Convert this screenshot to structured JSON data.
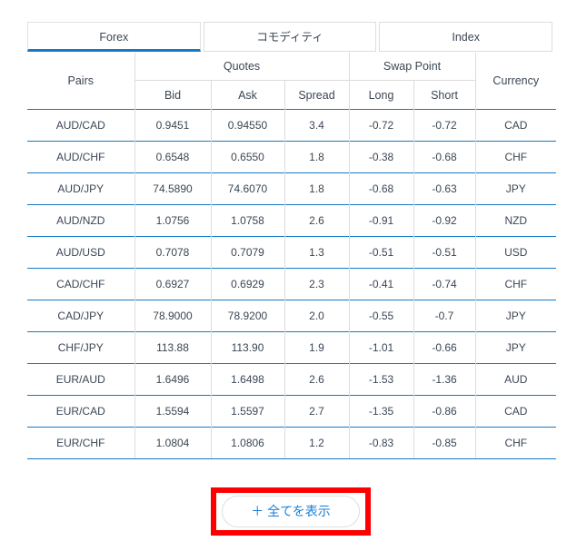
{
  "tabs": [
    {
      "label": "Forex",
      "active": true
    },
    {
      "label": "コモディティ",
      "active": false
    },
    {
      "label": "Index",
      "active": false
    }
  ],
  "table": {
    "headers": {
      "pairs": "Pairs",
      "quotes": "Quotes",
      "swap_point": "Swap Point",
      "currency": "Currency",
      "bid": "Bid",
      "ask": "Ask",
      "spread": "Spread",
      "long": "Long",
      "short": "Short"
    },
    "rows": [
      {
        "pair": "AUD/CAD",
        "bid": "0.9451",
        "ask": "0.94550",
        "spread": "3.4",
        "long": "-0.72",
        "short": "-0.72",
        "currency": "CAD"
      },
      {
        "pair": "AUD/CHF",
        "bid": "0.6548",
        "ask": "0.6550",
        "spread": "1.8",
        "long": "-0.38",
        "short": "-0.68",
        "currency": "CHF"
      },
      {
        "pair": "AUD/JPY",
        "bid": "74.5890",
        "ask": "74.6070",
        "spread": "1.8",
        "long": "-0.68",
        "short": "-0.63",
        "currency": "JPY"
      },
      {
        "pair": "AUD/NZD",
        "bid": "1.0756",
        "ask": "1.0758",
        "spread": "2.6",
        "long": "-0.91",
        "short": "-0.92",
        "currency": "NZD"
      },
      {
        "pair": "AUD/USD",
        "bid": "0.7078",
        "ask": "0.7079",
        "spread": "1.3",
        "long": "-0.51",
        "short": "-0.51",
        "currency": "USD"
      },
      {
        "pair": "CAD/CHF",
        "bid": "0.6927",
        "ask": "0.6929",
        "spread": "2.3",
        "long": "-0.41",
        "short": "-0.74",
        "currency": "CHF"
      },
      {
        "pair": "CAD/JPY",
        "bid": "78.9000",
        "ask": "78.9200",
        "spread": "2.0",
        "long": "-0.55",
        "short": "-0.7",
        "currency": "JPY"
      },
      {
        "pair": "CHF/JPY",
        "bid": "113.88",
        "ask": "113.90",
        "spread": "1.9",
        "long": "-1.01",
        "short": "-0.66",
        "currency": "JPY"
      },
      {
        "pair": "EUR/AUD",
        "bid": "1.6496",
        "ask": "1.6498",
        "spread": "2.6",
        "long": "-1.53",
        "short": "-1.36",
        "currency": "AUD"
      },
      {
        "pair": "EUR/CAD",
        "bid": "1.5594",
        "ask": "1.5597",
        "spread": "2.7",
        "long": "-1.35",
        "short": "-0.86",
        "currency": "CAD"
      },
      {
        "pair": "EUR/CHF",
        "bid": "1.0804",
        "ask": "1.0806",
        "spread": "1.2",
        "long": "-0.83",
        "short": "-0.85",
        "currency": "CHF"
      }
    ]
  },
  "show_all_button": {
    "label": "＋ 全てを表示"
  },
  "colors": {
    "accent_blue": "#1579c4",
    "link_blue": "#1a7fd4",
    "annotation_red": "#fe0000",
    "divider_gray": "#dcdcdc",
    "text": "#3b4653"
  }
}
